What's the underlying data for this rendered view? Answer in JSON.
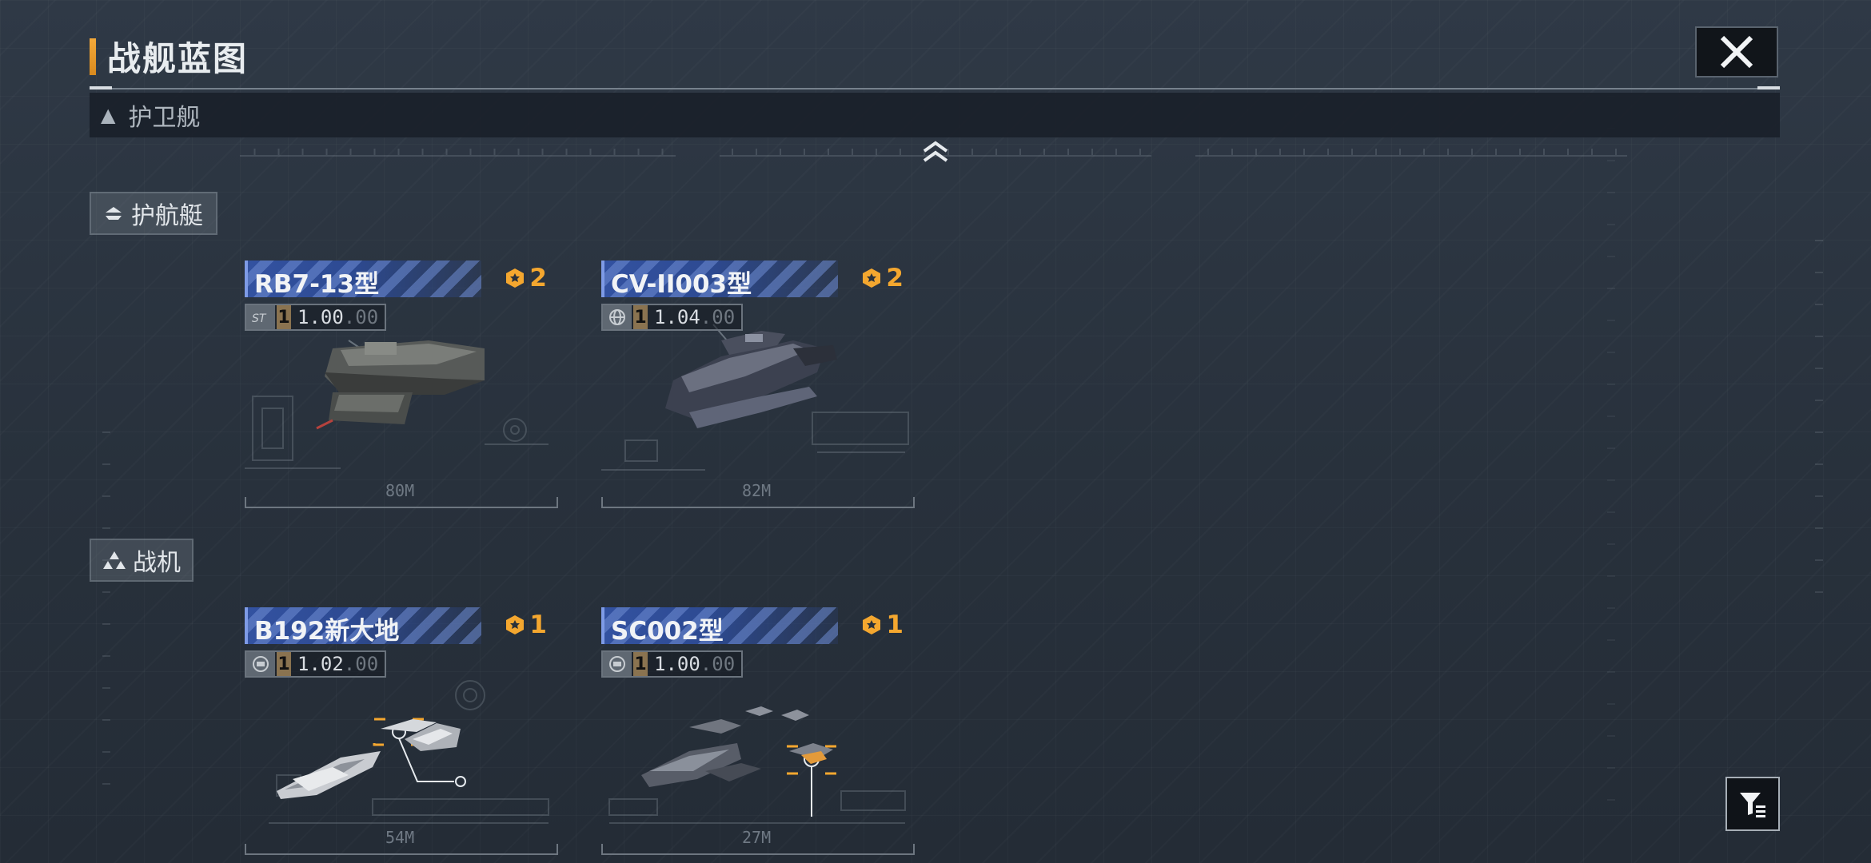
{
  "header": {
    "title": "战舰蓝图"
  },
  "class_bar": {
    "label": "护卫舰"
  },
  "sections": [
    {
      "label": "护航艇",
      "cards": [
        {
          "name": "RB7-13型",
          "count": "2",
          "tier": "1",
          "value_main": "1.00",
          "value_dim": ".00",
          "length": "80M"
        },
        {
          "name": "CV-II003型",
          "count": "2",
          "tier": "1",
          "value_main": "1.04",
          "value_dim": ".00",
          "length": "82M"
        }
      ]
    },
    {
      "label": "战机",
      "cards": [
        {
          "name": "B192新大地",
          "count": "1",
          "tier": "1",
          "value_main": "1.02",
          "value_dim": ".00",
          "length": "54M"
        },
        {
          "name": "SC002型",
          "count": "1",
          "tier": "1",
          "value_main": "1.00",
          "value_dim": ".00",
          "length": "27M"
        }
      ]
    }
  ],
  "icons": {
    "close": "close-icon",
    "filter": "filter-icon",
    "collapse": "chevron-up-icon",
    "count": "medal-icon"
  },
  "colors": {
    "accent_orange": "#f3a93a",
    "card_blue": "#3352a1",
    "count_orange": "#f4a72f"
  }
}
